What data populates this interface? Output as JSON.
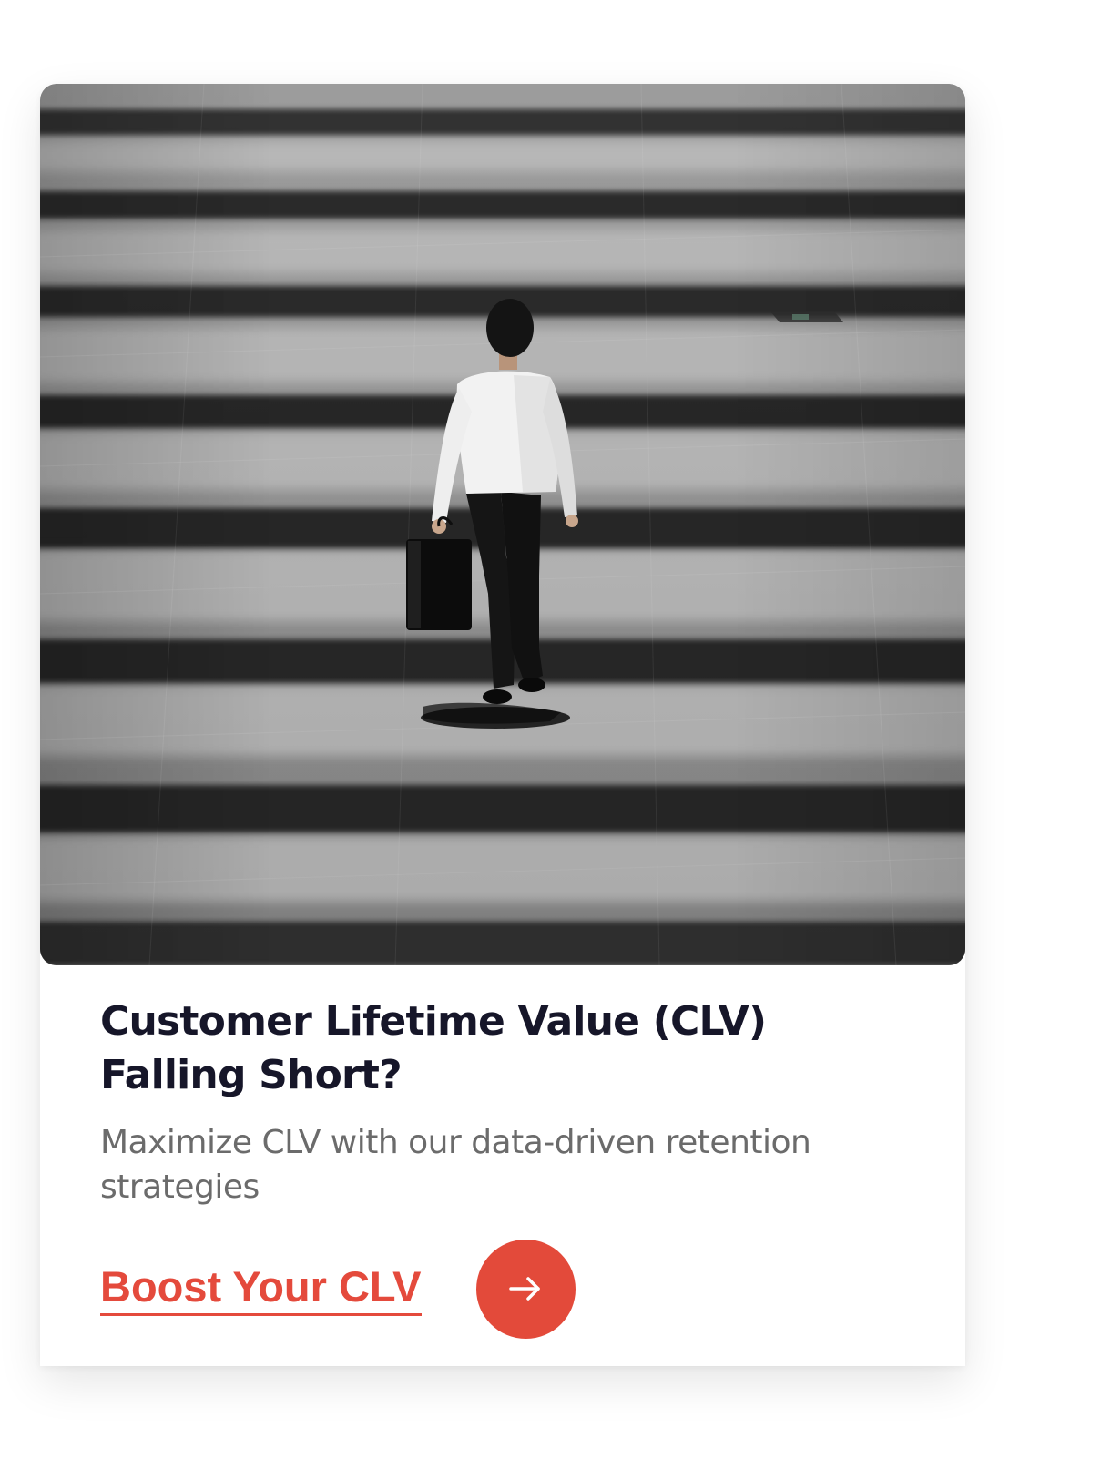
{
  "card": {
    "image": {
      "alt_subject": "businessman-walking-photo"
    },
    "title": "Customer Lifetime Value (CLV) Falling Short?",
    "subtitle": "Maximize CLV with our data-driven retention strategies",
    "cta": {
      "label": "Boost Your CLV",
      "arrow_icon": "arrow-right-icon"
    }
  },
  "colors": {
    "accent": "#e34a3a",
    "title": "#161629",
    "subtitle": "#6b6b6b",
    "background": "#ffffff"
  }
}
